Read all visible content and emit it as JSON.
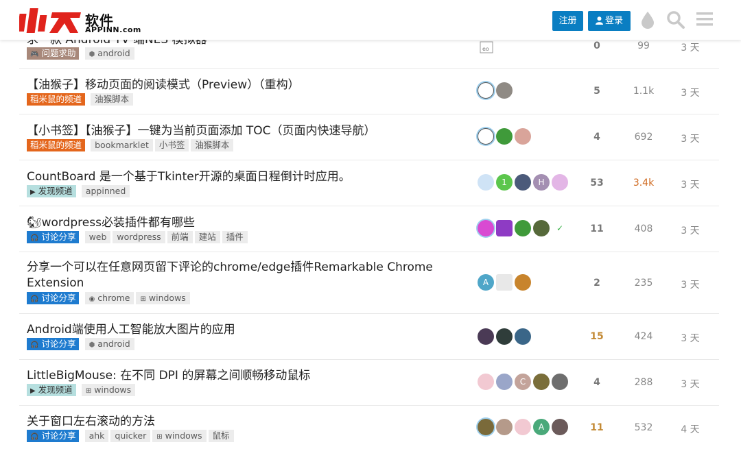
{
  "header": {
    "logo_cn": "软件",
    "logo_en": "APPINN.com",
    "signup_label": "注册",
    "login_label": "登录",
    "icons": [
      "drop-icon",
      "search-icon",
      "menu-icon"
    ]
  },
  "topics": [
    {
      "title": "求一款 Android TV 端NES 模拟器",
      "category": "问题求助",
      "tags": [
        "android"
      ],
      "replies": "0",
      "views": "99",
      "activity": "3 天"
    },
    {
      "title": "【油猴子】移动页面的阅读模式（Preview）（重构）",
      "category": "稻米鼠的频道",
      "tags": [
        "油猴脚本"
      ],
      "replies": "5",
      "views": "1.1k",
      "activity": "3 天"
    },
    {
      "title": "【小书签】【油猴子】一键为当前页面添加 TOC（页面内快速导航）",
      "category": "稻米鼠的频道",
      "tags": [
        "bookmarklet",
        "小书签",
        "油猴脚本"
      ],
      "replies": "4",
      "views": "692",
      "activity": "3 天"
    },
    {
      "title": "CountBoard 是一个基于Tkinter开源的桌面日程倒计时应用。",
      "category": "发现频道",
      "tags": [
        "appinned"
      ],
      "replies": "53",
      "views": "3.4k",
      "activity": "3 天"
    },
    {
      "title": "wordpress必装插件都有哪些",
      "category": "讨论分享",
      "tags": [
        "web",
        "wordpress",
        "前端",
        "建站",
        "插件"
      ],
      "replies": "11",
      "views": "408",
      "activity": "3 天"
    },
    {
      "title": "分享一个可以在任意网页留下评论的chrome/edge插件Remarkable Chrome Extension",
      "category": "讨论分享",
      "tags": [
        "chrome",
        "windows"
      ],
      "replies": "2",
      "views": "235",
      "activity": "3 天"
    },
    {
      "title": "Android端使用人工智能放大图片的应用",
      "category": "讨论分享",
      "tags": [
        "android"
      ],
      "replies": "15",
      "views": "424",
      "activity": "3 天"
    },
    {
      "title": "LittleBigMouse: 在不同 DPI 的屏幕之间顺畅移动鼠标",
      "category": "发现频道",
      "tags": [
        "windows"
      ],
      "replies": "4",
      "views": "288",
      "activity": "3 天"
    },
    {
      "title": "关于窗口左右滚动的方法",
      "category": "讨论分享",
      "tags": [
        "ahk",
        "quicker",
        "windows",
        "鼠标"
      ],
      "replies": "11",
      "views": "532",
      "activity": "4 天"
    }
  ],
  "avatar_letters": [
    "1",
    "H",
    "A",
    "C",
    "A"
  ],
  "colors": {
    "brand_red": "#e0231c",
    "button_blue": "#0a7ec2",
    "cat_discuss": "#1e7bcf",
    "cat_discover": "#b6dfdf",
    "cat_daomi": "#e4661c",
    "cat_help": "#a8887a",
    "hot_replies": "#c38a35",
    "hot_views": "#d06d25"
  }
}
